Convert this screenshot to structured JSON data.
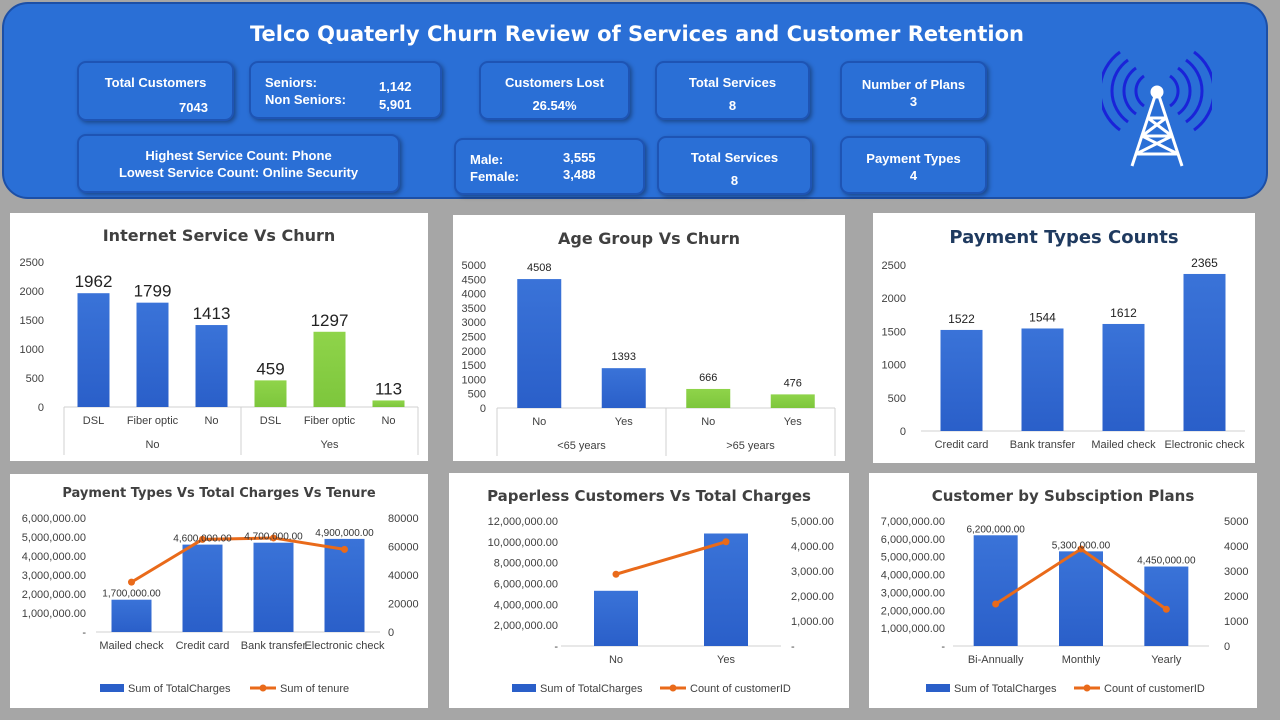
{
  "header": {
    "title": "Telco Quaterly Churn Review of Services and Customer Retention",
    "kpis": {
      "total_customers": {
        "label": "Total Customers",
        "value": "7043"
      },
      "seniors": {
        "seniors_label": "Seniors:",
        "seniors_value": "1,142",
        "non_label": "Non Seniors:",
        "non_value": "5,901"
      },
      "customers_lost": {
        "label": "Customers Lost",
        "value": "26.54%"
      },
      "total_services_1": {
        "label": "Total Services",
        "value": "8"
      },
      "number_of_plans": {
        "label": "Number of Plans",
        "value": "3"
      },
      "service_count": {
        "highest": "Highest Service Count: Phone",
        "lowest": "Lowest Service Count: Online Security"
      },
      "gender": {
        "male_label": "Male:",
        "male_value": "3,555",
        "female_label": "Female:",
        "female_value": "3,488"
      },
      "total_services_2": {
        "label": "Total Services",
        "value": "8"
      },
      "payment_types": {
        "label": "Payment Types",
        "value": "4"
      }
    },
    "logo_icon": "radio-tower-icon",
    "colors": {
      "header_blue": "#2a6fd6",
      "bar_blue": "#2a5fc9",
      "bar_green": "#7dc63c",
      "line_orange": "#e96a1a"
    }
  },
  "chart_data": [
    {
      "type": "bar",
      "title": "Internet Service Vs Churn",
      "categories": [
        "DSL",
        "Fiber optic",
        "No",
        "DSL",
        "Fiber optic",
        "No"
      ],
      "groups": [
        {
          "label": "No",
          "count": 3
        },
        {
          "label": "Yes",
          "count": 3
        }
      ],
      "values": [
        1962,
        1799,
        1413,
        459,
        1297,
        113
      ],
      "data_labels": [
        "1962",
        "1799",
        "1413",
        "459",
        "1297",
        "113"
      ],
      "bar_colors": [
        "#2a5fc9",
        "#2a5fc9",
        "#2a5fc9",
        "#7dc63c",
        "#7dc63c",
        "#7dc63c"
      ],
      "ylim": [
        0,
        2500
      ],
      "yticks": [
        "0",
        "500",
        "1000",
        "1500",
        "2000",
        "2500"
      ]
    },
    {
      "type": "bar",
      "title": "Age Group Vs Churn",
      "categories": [
        "No",
        "Yes",
        "No",
        "Yes"
      ],
      "groups": [
        {
          "label": "<65 years",
          "count": 2
        },
        {
          "label": ">65 years",
          "count": 2
        }
      ],
      "values": [
        4508,
        1393,
        666,
        476
      ],
      "data_labels": [
        "4508",
        "1393",
        "666",
        "476"
      ],
      "bar_colors": [
        "#2a5fc9",
        "#2a5fc9",
        "#7dc63c",
        "#7dc63c"
      ],
      "ylim": [
        0,
        5000
      ],
      "yticks": [
        "0",
        "500",
        "1000",
        "1500",
        "2000",
        "2500",
        "3000",
        "3500",
        "4000",
        "4500",
        "5000"
      ]
    },
    {
      "type": "bar",
      "title": "Payment Types Counts",
      "categories": [
        "Credit card",
        "Bank transfer",
        "Mailed check",
        "Electronic check"
      ],
      "values": [
        1522,
        1544,
        1612,
        2365
      ],
      "data_labels": [
        "1522",
        "1544",
        "1612",
        "2365"
      ],
      "ylim": [
        0,
        2500
      ],
      "yticks": [
        "0",
        "500",
        "1000",
        "1500",
        "2000",
        "2500"
      ]
    },
    {
      "type": "bar",
      "title": "Payment Types Vs Total Charges Vs Tenure",
      "categories": [
        "Mailed check",
        "Credit card",
        "Bank transfer",
        "Electronic check"
      ],
      "series": [
        {
          "name": "Sum of TotalCharges",
          "kind": "bar",
          "axis": "left",
          "values": [
            1700000,
            4600000,
            4700000,
            4900000
          ]
        },
        {
          "name": "Sum of tenure",
          "kind": "line",
          "axis": "right",
          "values": [
            35000,
            65000,
            66000,
            58000
          ]
        }
      ],
      "data_labels": [
        "1,700,000.00",
        "4,600,000.00",
        "4,700,000.00",
        "4,900,000.00"
      ],
      "ylim_left": [
        0,
        6000000
      ],
      "ylim_right": [
        0,
        80000
      ],
      "yticks_left": [
        "-",
        "1,000,000.00",
        "2,000,000.00",
        "3,000,000.00",
        "4,000,000.00",
        "5,000,000.00",
        "6,000,000.00"
      ],
      "yticks_right": [
        "0",
        "20000",
        "40000",
        "60000",
        "80000"
      ]
    },
    {
      "type": "bar",
      "title": "Paperless Customers Vs Total Charges",
      "categories": [
        "No",
        "Yes"
      ],
      "series": [
        {
          "name": "Sum of TotalCharges",
          "kind": "bar",
          "axis": "left",
          "values": [
            5300000,
            10800000
          ]
        },
        {
          "name": "Count of customerID",
          "kind": "line",
          "axis": "right",
          "values": [
            2870,
            4170
          ]
        }
      ],
      "ylim_left": [
        0,
        12000000
      ],
      "ylim_right": [
        0,
        5000
      ],
      "yticks_left": [
        "-",
        "2,000,000.00",
        "4,000,000.00",
        "6,000,000.00",
        "8,000,000.00",
        "10,000,000.00",
        "12,000,000.00"
      ],
      "yticks_right": [
        "-",
        "1,000.00",
        "2,000.00",
        "3,000.00",
        "4,000.00",
        "5,000.00"
      ]
    },
    {
      "type": "bar",
      "title": "Customer by Subsciption Plans",
      "categories": [
        "Bi-Annually",
        "Monthly",
        "Yearly"
      ],
      "series": [
        {
          "name": "Sum of TotalCharges",
          "kind": "bar",
          "axis": "left",
          "values": [
            6200000,
            5300000,
            4450000
          ]
        },
        {
          "name": "Count of customerID",
          "kind": "line",
          "axis": "right",
          "values": [
            1680,
            3880,
            1470
          ]
        }
      ],
      "data_labels": [
        "6,200,000.00",
        "5,300,000.00",
        "4,450,000.00"
      ],
      "ylim_left": [
        0,
        7000000
      ],
      "ylim_right": [
        0,
        5000
      ],
      "yticks_left": [
        "-",
        "1,000,000.00",
        "2,000,000.00",
        "3,000,000.00",
        "4,000,000.00",
        "5,000,000.00",
        "6,000,000.00",
        "7,000,000.00"
      ],
      "yticks_right": [
        "0",
        "1000",
        "2000",
        "3000",
        "4000",
        "5000"
      ]
    }
  ]
}
